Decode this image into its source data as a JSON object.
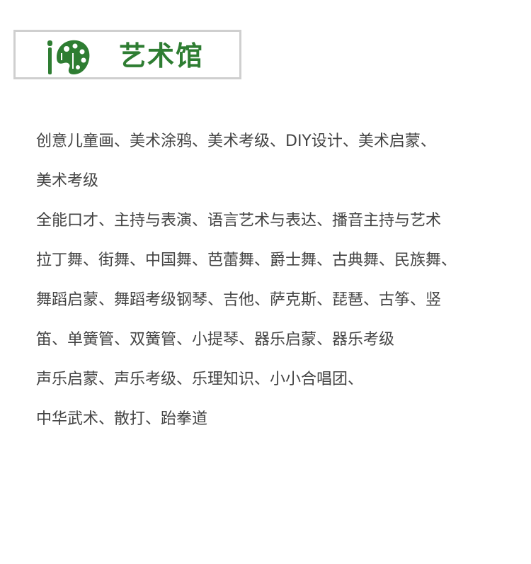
{
  "header": {
    "title": "艺术馆",
    "logo_icon": "palette-brush-icon",
    "accent_color": "#2e7d32"
  },
  "content": {
    "lines": [
      "创意儿童画、美术涂鸦、美术考级、DIY设计、美术启蒙、",
      "美术考级",
      "全能口才、主持与表演、语言艺术与表达、播音主持与艺术",
      "拉丁舞、街舞、中国舞、芭蕾舞、爵士舞、古典舞、民族舞、",
      "舞蹈启蒙、舞蹈考级钢琴、吉他、萨克斯、琵琶、古筝、竖",
      "笛、单簧管、双簧管、小提琴、器乐启蒙、器乐考级",
      "声乐启蒙、声乐考级、乐理知识、小小合唱团、",
      "中华武术、散打、跆拳道"
    ]
  }
}
